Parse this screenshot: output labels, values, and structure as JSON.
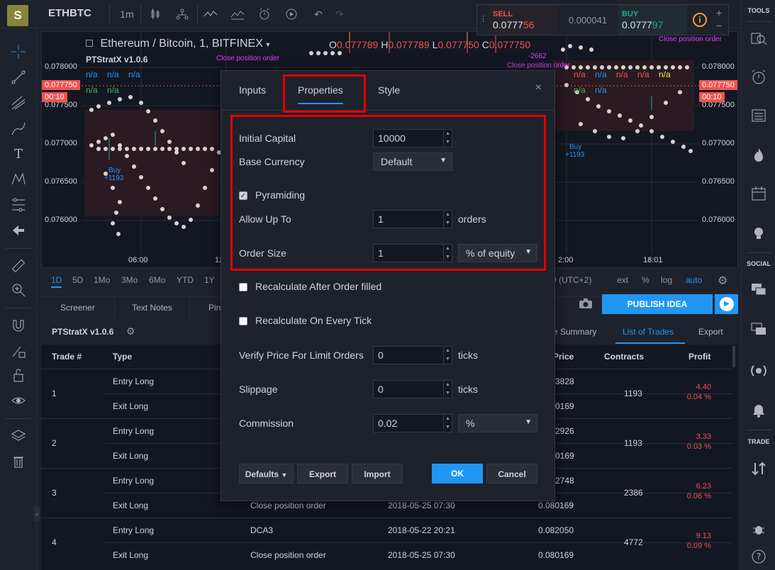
{
  "header": {
    "logo": "S",
    "symbol": "ETHBTC",
    "interval": "1m",
    "icons": [
      "candles-icon",
      "compare-icon",
      "indicators-icon",
      "templates-icon",
      "alert-icon",
      "replay-icon",
      "undo-icon",
      "redo-icon"
    ]
  },
  "trade": {
    "sell_label": "SELL",
    "sell_price_main": "0.0777",
    "sell_price_hl": "56",
    "spread": "0.000041",
    "buy_label": "BUY",
    "buy_price_main": "0.0777",
    "buy_price_hl": "97",
    "info": "i",
    "plus": "+",
    "minus": "−"
  },
  "chart": {
    "title": "Ethereum / Bitcoin, 1, BITFINEX",
    "ohlc": {
      "o_label": "O",
      "o": "0.077789",
      "h_label": "H",
      "h": "0.077789",
      "l_label": "L",
      "l": "0.077750",
      "c_label": "C",
      "c": "0.077750"
    },
    "study": "PTStratX v1.0.6",
    "na": "n/a",
    "annotations": {
      "close_pos": "Close position order",
      "close_val": "-2662",
      "buy": "Buy",
      "buy_val": "+1193"
    },
    "price_levels": [
      "0.078000",
      "0.077500",
      "0.077000",
      "0.076500",
      "0.076000"
    ],
    "current_price": "0.077750",
    "countdown": "00:10",
    "time_labels": [
      "06:00",
      "12",
      "2:00",
      "18:01"
    ]
  },
  "range_bar": {
    "ranges": [
      "1D",
      "5D",
      "1Mo",
      "3Mo",
      "6Mo",
      "YTD",
      "1Y"
    ],
    "timezone": "9 (UTC+2)",
    "options": [
      "ext",
      "%",
      "log",
      "auto"
    ]
  },
  "bottom_tabs": [
    "Screener",
    "Text Notes",
    "Pine"
  ],
  "publish_label": "PUBLISH IDEA",
  "strategy": {
    "name": "PTStratX v1.0.6",
    "tabs": [
      "e Summary",
      "List of Trades",
      "Export"
    ],
    "columns": [
      "Trade #",
      "Type",
      "Price",
      "Contracts",
      "Profit"
    ],
    "trades": [
      {
        "num": "1",
        "entry_type": "Entry Long",
        "exit_type": "Exit Long",
        "entry_signal": "",
        "exit_signal": "",
        "entry_date": "",
        "exit_date": "",
        "entry_price": "3828",
        "exit_price": "0169",
        "contracts": "1193",
        "profit": "4.40",
        "profit_pct": "0.04 %"
      },
      {
        "num": "2",
        "entry_type": "Entry Long",
        "exit_type": "Exit Long",
        "entry_signal": "",
        "exit_signal": "",
        "entry_date": "",
        "exit_date": "",
        "entry_price": "2926",
        "exit_price": "0169",
        "contracts": "1193",
        "profit": "3.33",
        "profit_pct": "0.03 %"
      },
      {
        "num": "3",
        "entry_type": "Entry Long",
        "exit_type": "Exit Long",
        "entry_signal": "",
        "exit_signal": "Close position order",
        "entry_date": "",
        "exit_date": "2018-05-25 07:30",
        "entry_price": "2748",
        "exit_price": "0.080169",
        "contracts": "2386",
        "profit": "6.23",
        "profit_pct": "0.06 %"
      },
      {
        "num": "4",
        "entry_type": "Entry Long",
        "exit_type": "Exit Long",
        "entry_signal": "DCA3",
        "exit_signal": "Close position order",
        "entry_date": "2018-05-22 20:21",
        "exit_date": "2018-05-25 07:30",
        "entry_price": "0.082050",
        "exit_price": "0.080169",
        "contracts": "4772",
        "profit": "9.13",
        "profit_pct": "0.09 %"
      }
    ]
  },
  "dialog": {
    "tabs": [
      "Inputs",
      "Properties",
      "Style"
    ],
    "close": "×",
    "initial_capital_label": "Initial Capital",
    "initial_capital": "10000",
    "base_currency_label": "Base Currency",
    "base_currency": "Default",
    "pyramiding_label": "Pyramiding",
    "allow_up_to_label": "Allow Up To",
    "allow_up_to": "1",
    "orders_unit": "orders",
    "order_size_label": "Order Size",
    "order_size": "1",
    "order_size_type": "% of equity",
    "recalc_after_fill": "Recalculate After Order filled",
    "recalc_every_tick": "Recalculate On Every Tick",
    "verify_price_label": "Verify Price For Limit Orders",
    "verify_price": "0",
    "ticks_unit": "ticks",
    "slippage_label": "Slippage",
    "slippage": "0",
    "commission_label": "Commission",
    "commission": "0.02",
    "commission_type": "%",
    "defaults_btn": "Defaults",
    "export_btn": "Export",
    "import_btn": "Import",
    "ok_btn": "OK",
    "cancel_btn": "Cancel"
  },
  "right_toolbar": {
    "tools_label": "TOOLS",
    "social_label": "SOCIAL",
    "trade_label": "TRADE"
  }
}
